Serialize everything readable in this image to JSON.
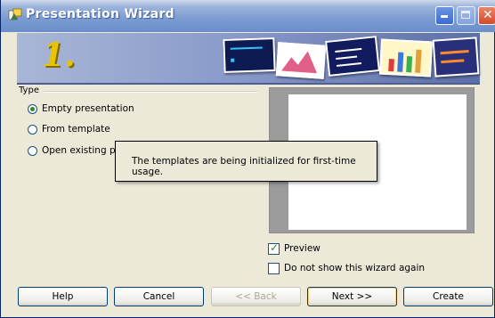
{
  "window": {
    "title": "Presentation Wizard",
    "icon": "impress-app-icon",
    "controls": [
      "minimize-icon",
      "maximize-icon",
      "close-icon"
    ]
  },
  "banner": {
    "step_number": "1."
  },
  "type_section": {
    "label": "Type",
    "options": [
      {
        "label": "Empty presentation",
        "selected": true
      },
      {
        "label": "From template",
        "selected": false
      },
      {
        "label": "Open existing pr",
        "selected": false
      }
    ]
  },
  "tooltip": {
    "message": "The templates are being initialized for first-time usage."
  },
  "preview_panel": {
    "preview_label": "Preview",
    "preview_checked": true,
    "dont_show_label": "Do not show this wizard again",
    "dont_show_checked": false
  },
  "buttons": {
    "help": "Help",
    "cancel": "Cancel",
    "back": "<< Back",
    "next": "Next >>",
    "create": "Create"
  },
  "colors": {
    "title_bar": "#7d9dd2",
    "dialog_bg": "#ece9d8",
    "step_number": "#e8c400"
  }
}
